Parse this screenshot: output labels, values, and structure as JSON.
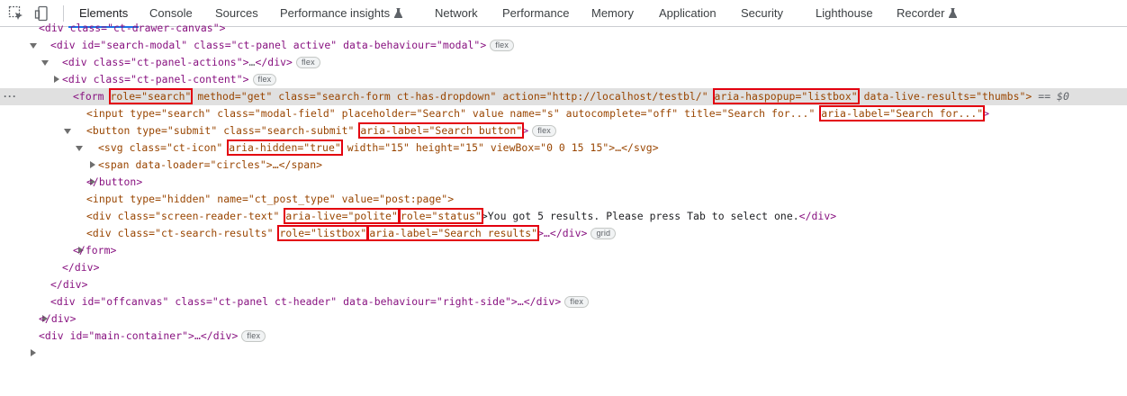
{
  "toolbar": {
    "tabs": [
      {
        "label": "Elements"
      },
      {
        "label": "Console"
      },
      {
        "label": "Sources"
      },
      {
        "label": "Performance insights"
      },
      {
        "label": "Network"
      },
      {
        "label": "Performance"
      },
      {
        "label": "Memory"
      },
      {
        "label": "Application"
      },
      {
        "label": "Security"
      },
      {
        "label": "Lighthouse"
      },
      {
        "label": "Recorder"
      }
    ],
    "active_tab": "Elements",
    "inspect_icon": "inspect-element-icon",
    "device_icon": "device-toolbar-icon",
    "experimental_icon": "flask-icon"
  },
  "colors": {
    "tag": "#881280",
    "attr_name": "#994500",
    "attr_value": "#1a1aa6",
    "highlight_box": "#e3000f",
    "selected_row": "#e0e0e0",
    "active_tab_underline": "#1a73e8"
  },
  "dom": {
    "r0": {
      "text": "<div class=\"ct-drawer-canvas\">"
    },
    "r1": {
      "open": "<div id=\"search-modal\" class=\"ct-panel active\" data-behaviour=\"modal\">",
      "badge": "flex"
    },
    "r2": {
      "open": "<div class=\"ct-panel-actions\">",
      "ellipsis": "…",
      "close": "</div>",
      "badge": "flex"
    },
    "r3": {
      "open": "<div class=\"ct-panel-content\">",
      "badge": "flex"
    },
    "r4": {
      "tag_open": "<form ",
      "role": "role=\"search\"",
      "mid": " method=\"get\" class=\"search-form ct-has-dropdown\" action=\"http://localhost/testbl/\" ",
      "haspopup": "aria-haspopup=\"listbox\"",
      "live_results": " data-live-results=\"thumbs\">",
      "eq": " == $0"
    },
    "r5": {
      "text": "<input type=\"search\" class=\"modal-field\" placeholder=\"Search\" value name=\"s\" autocomplete=\"off\" title=\"Search for...\" ",
      "aria_label": "aria-label=\"Search for...\"",
      "close": ">"
    },
    "r6": {
      "text": "<button type=\"submit\" class=\"search-submit\" ",
      "aria_label": "aria-label=\"Search button\"",
      "close": ">",
      "badge": "flex"
    },
    "r7": {
      "text": "<svg class=\"ct-icon\" ",
      "aria_hidden": "aria-hidden=\"true\"",
      "rest": " width=\"15\" height=\"15\" viewBox=\"0 0 15 15\">…</svg>"
    },
    "r8": {
      "text": "<span data-loader=\"circles\">…</span>"
    },
    "r9": {
      "text": "</button>"
    },
    "r10": {
      "text": "<input type=\"hidden\" name=\"ct_post_type\" value=\"post:page\">"
    },
    "r11": {
      "text": "<div class=\"screen-reader-text\" ",
      "aria_live": "aria-live=\"polite\"",
      "role": "role=\"status\"",
      "content": ">You got 5 results. Please press Tab to select one.",
      "close": "</div>"
    },
    "r12": {
      "text": "<div class=\"ct-search-results\" ",
      "role": "role=\"listbox\"",
      "aria_label": "aria-label=\"Search results\"",
      "rest": ">…</div>",
      "badge": "grid"
    },
    "r13": {
      "text": "</form>"
    },
    "r14": {
      "text": "</div>"
    },
    "r15": {
      "text": "</div>"
    },
    "r16": {
      "text": "<div id=\"offcanvas\" class=\"ct-panel ct-header\" data-behaviour=\"right-side\">…</div>",
      "badge": "flex"
    },
    "r17": {
      "text": "</div>"
    },
    "r18": {
      "text": "<div id=\"main-container\">…</div>",
      "badge": "flex"
    }
  }
}
